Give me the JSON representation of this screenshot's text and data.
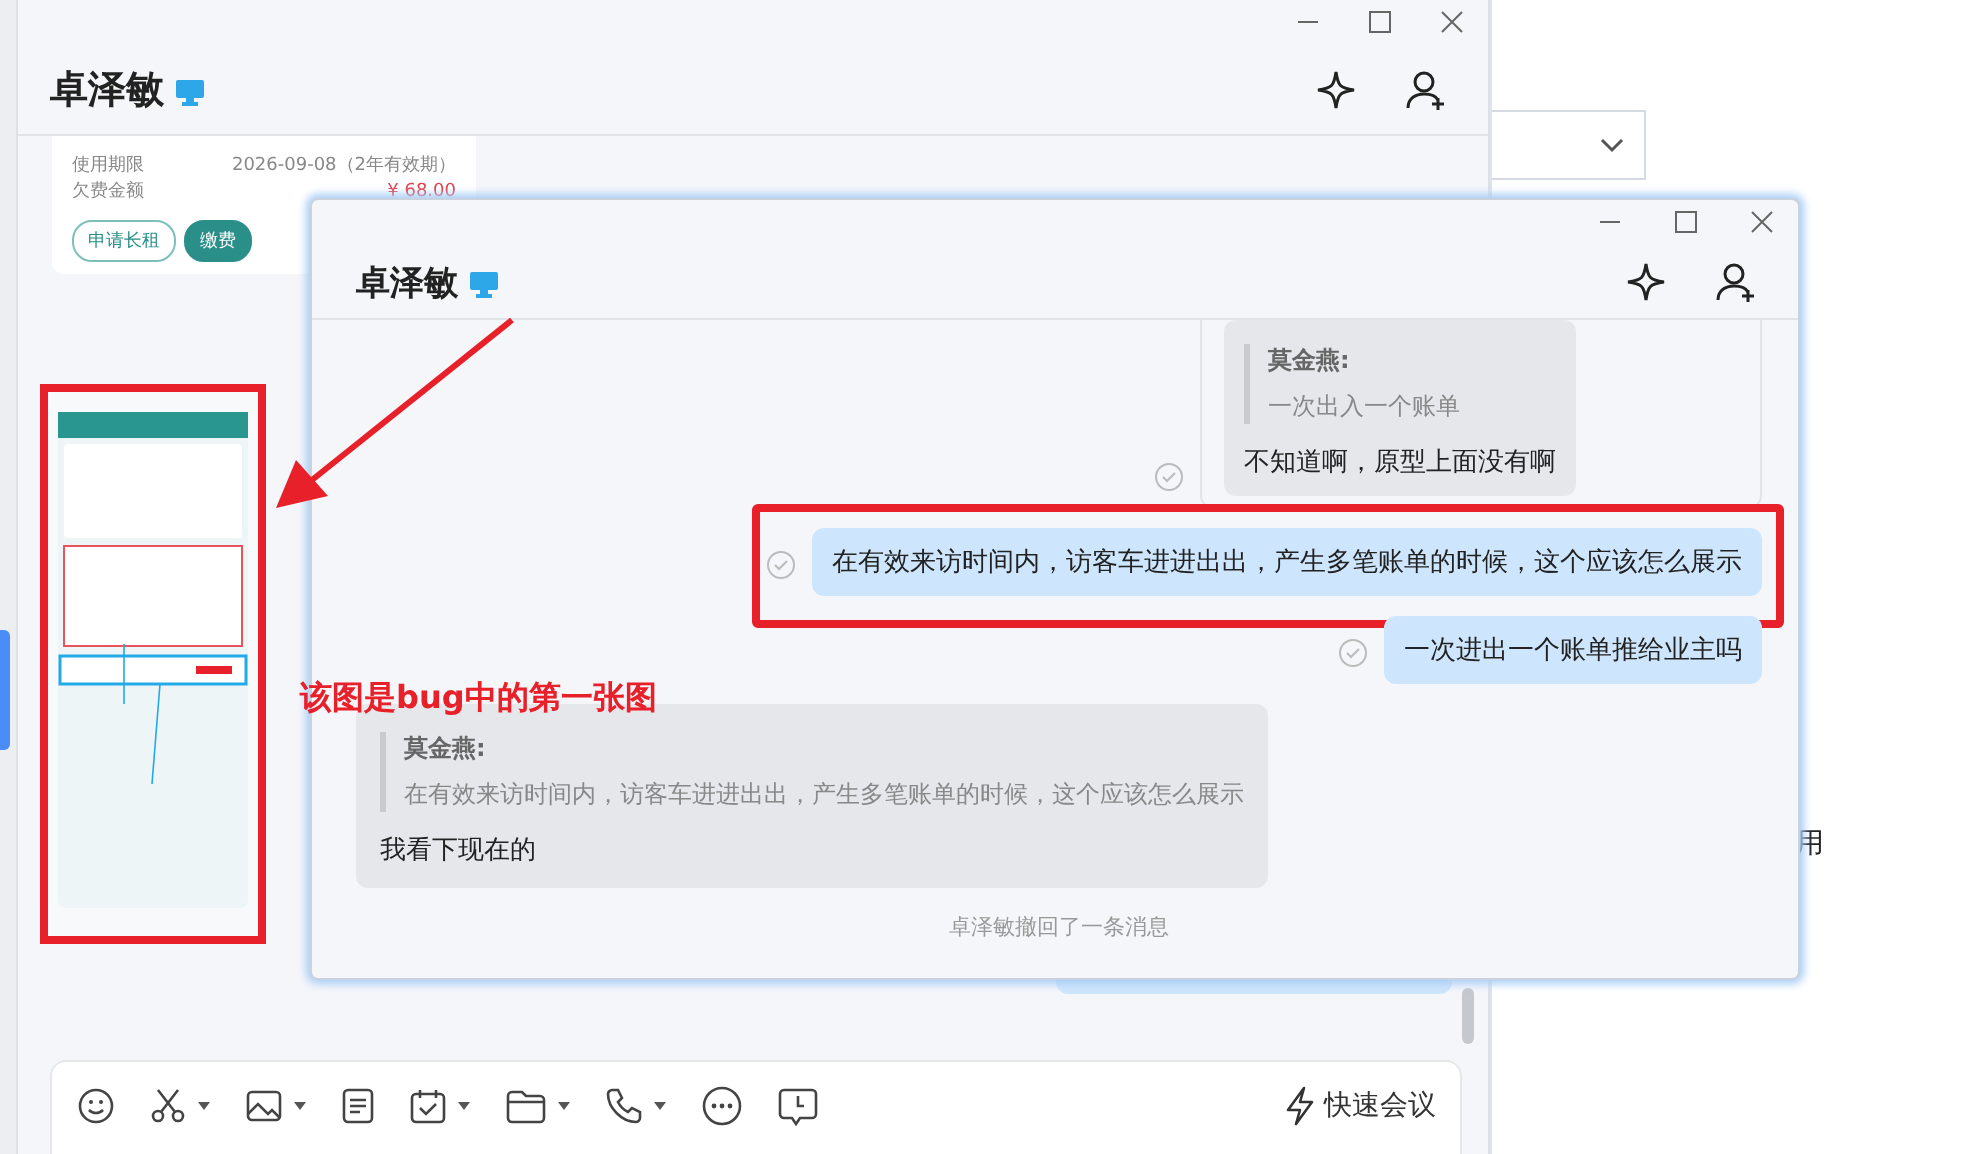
{
  "background_app": {
    "cell_text": "用"
  },
  "back_window": {
    "title": "卓泽敏",
    "card": {
      "rows": [
        {
          "label": "使用期限",
          "value": "2026-09-08（2年有效期）",
          "kind": "plain"
        },
        {
          "label": "欠费金额",
          "value": "¥ 68.00",
          "kind": "amount"
        }
      ],
      "buttons": [
        {
          "label": "申请长租",
          "kind": "outline"
        },
        {
          "label": "缴费",
          "kind": "primary"
        }
      ]
    },
    "toolbar": {
      "quick_meeting": "快速会议"
    }
  },
  "front_window": {
    "title": "卓泽敏",
    "messages": [
      {
        "kind": "reply-out",
        "quote": {
          "author": "莫金燕:",
          "text": "一次出入一个账单"
        },
        "text": "不知道啊，原型上面没有啊",
        "hovered": true,
        "annotated": false
      },
      {
        "kind": "out",
        "text": "在有效来访时间内，访客车进进出出，产生多笔账单的时候，这个应该怎么展示",
        "hovered": false,
        "annotated": true
      },
      {
        "kind": "out",
        "text": "一次进出一个账单推给业主吗",
        "hovered": false,
        "annotated": false
      },
      {
        "kind": "in",
        "quote": {
          "author": "莫金燕:",
          "text": "在有效来访时间内，访客车进进出出，产生多笔账单的时候，这个应该怎么展示"
        },
        "text": "我看下现在的",
        "hovered": false,
        "annotated": false
      },
      {
        "kind": "system",
        "text": "卓泽敏撤回了一条消息"
      }
    ]
  },
  "annotation": {
    "text": "该图是bug中的第一张图"
  }
}
